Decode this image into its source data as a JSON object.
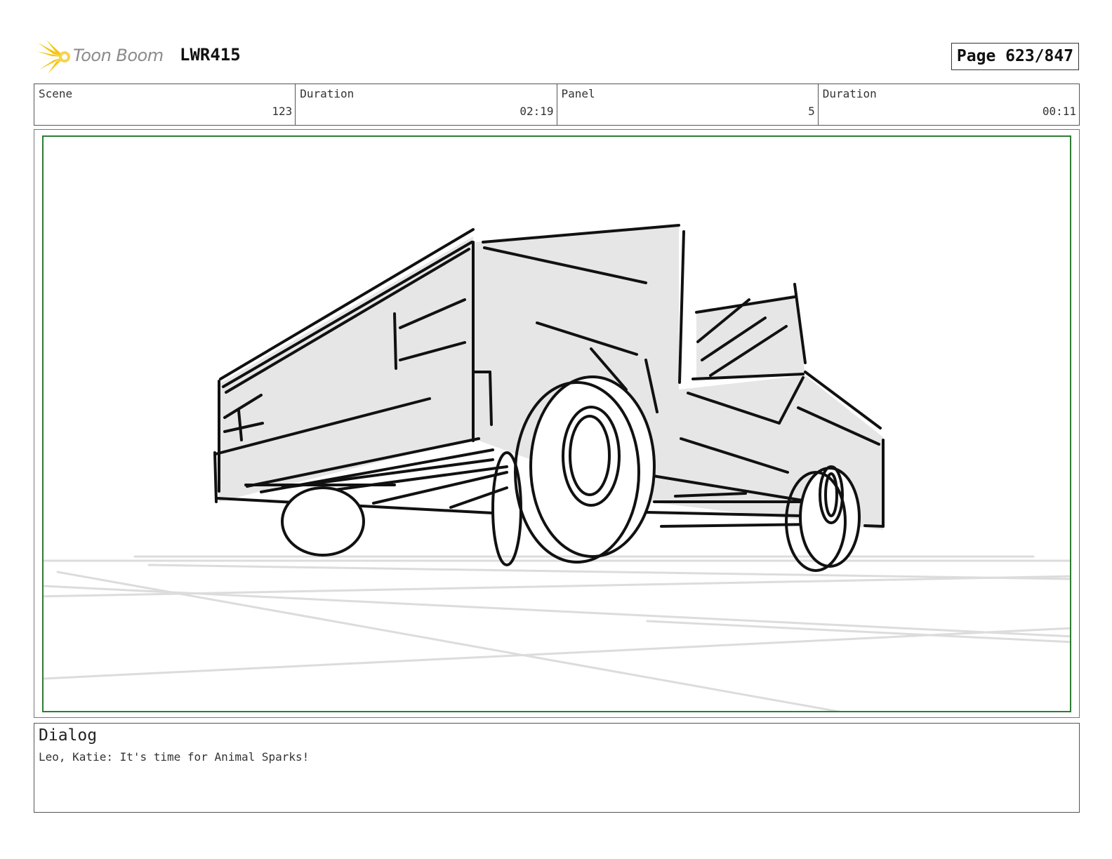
{
  "header": {
    "logo_text": "Toon Boom",
    "logo_icon": "sunburst-logo-icon",
    "project_code": "LWR415",
    "page_counter": "Page 623/847"
  },
  "info": {
    "scene_label": "Scene",
    "scene_value": "123",
    "scene_duration_label": "Duration",
    "scene_duration_value": "02:19",
    "panel_label": "Panel",
    "panel_value": "5",
    "panel_duration_label": "Duration",
    "panel_duration_value": "00:11"
  },
  "panel": {
    "frame_color": "#2e7d32",
    "sketch_description": "truck-sketch"
  },
  "dialog": {
    "title": "Dialog",
    "text": "Leo, Katie: It's time for Animal Sparks!"
  },
  "colors": {
    "logo_yellow": "#f5c518",
    "sketch_fill": "#e6e6e6",
    "ink": "#111111"
  }
}
